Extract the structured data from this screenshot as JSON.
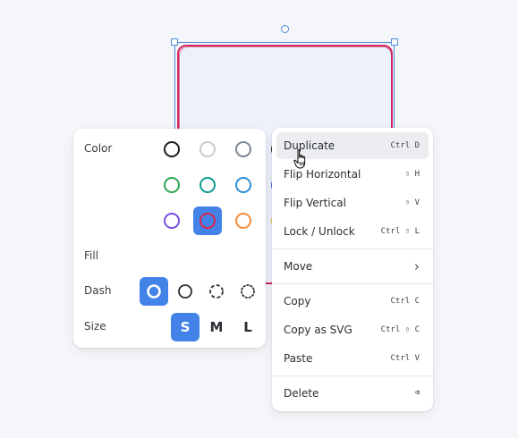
{
  "style_panel": {
    "color_label": "Color",
    "fill_label": "Fill",
    "dash_label": "Dash",
    "size_label": "Size",
    "colors": [
      "#1d1d1d",
      "#c8cbd1",
      "#7e8794",
      "#1d1d1d",
      "#2fa553",
      "#0f9c96",
      "#2a8ed8",
      "#4263eb",
      "#7b4fdf",
      "#e0254d",
      "#f28c3a",
      "#f7c350"
    ],
    "selected_color": "#e0254d",
    "dash_options": [
      "draw",
      "solid",
      "dashed",
      "dotted"
    ],
    "selected_dash": "draw",
    "sizes": [
      "S",
      "M",
      "L"
    ],
    "selected_size": "S"
  },
  "context_menu": {
    "items": [
      {
        "label": "Duplicate",
        "shortcut": "Ctrl D"
      },
      {
        "label": "Flip Horizontal",
        "shortcut": "⇧ H"
      },
      {
        "label": "Flip Vertical",
        "shortcut": "⇧ V"
      },
      {
        "label": "Lock / Unlock",
        "shortcut": "Ctrl ⇧ L"
      },
      {
        "label": "Move",
        "shortcut": ""
      },
      {
        "label": "Copy",
        "shortcut": "Ctrl C"
      },
      {
        "label": "Copy as SVG",
        "shortcut": "Ctrl ⇧ C"
      },
      {
        "label": "Paste",
        "shortcut": "Ctrl V"
      },
      {
        "label": "Delete",
        "shortcut": "⌫"
      }
    ],
    "hovered_item": "Duplicate"
  },
  "theme": {
    "accent": "#4383e8",
    "selection": "#4a8ad8",
    "shape_stroke": "#d5285e",
    "shape_fill": "#edf1fb"
  },
  "icons": {
    "submenu": "chevron-right-icon",
    "cursor": "hand-pointer-icon"
  }
}
